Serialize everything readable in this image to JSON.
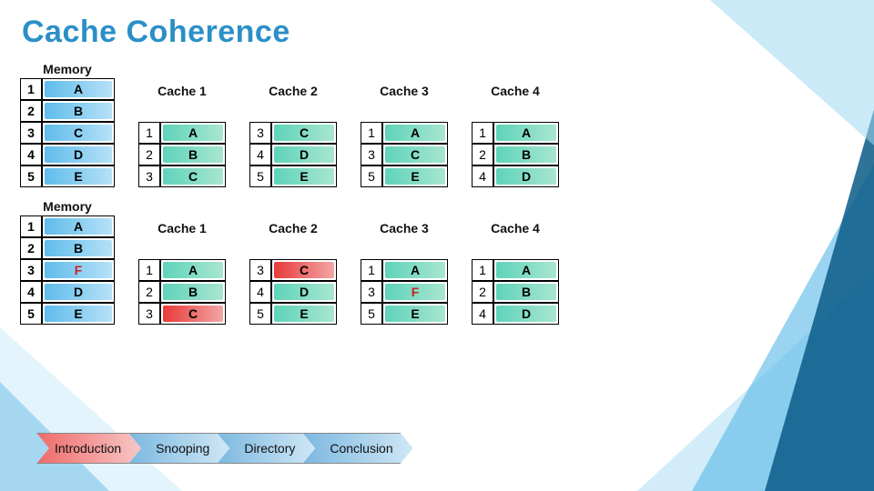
{
  "title": "Cache Coherence",
  "top": {
    "memory": {
      "header": "Memory",
      "rows": [
        {
          "i": "1",
          "v": "A",
          "bg": "blue"
        },
        {
          "i": "2",
          "v": "B",
          "bg": "blue"
        },
        {
          "i": "3",
          "v": "C",
          "bg": "blue"
        },
        {
          "i": "4",
          "v": "D",
          "bg": "blue"
        },
        {
          "i": "5",
          "v": "E",
          "bg": "blue"
        }
      ]
    },
    "caches": [
      {
        "header": "Cache 1",
        "rows": [
          {
            "i": "1",
            "v": "A",
            "bg": "teal"
          },
          {
            "i": "2",
            "v": "B",
            "bg": "teal"
          },
          {
            "i": "3",
            "v": "C",
            "bg": "teal"
          }
        ]
      },
      {
        "header": "Cache 2",
        "rows": [
          {
            "i": "3",
            "v": "C",
            "bg": "teal"
          },
          {
            "i": "4",
            "v": "D",
            "bg": "teal"
          },
          {
            "i": "5",
            "v": "E",
            "bg": "teal"
          }
        ]
      },
      {
        "header": "Cache 3",
        "rows": [
          {
            "i": "1",
            "v": "A",
            "bg": "teal"
          },
          {
            "i": "3",
            "v": "C",
            "bg": "teal"
          },
          {
            "i": "5",
            "v": "E",
            "bg": "teal"
          }
        ]
      },
      {
        "header": "Cache 4",
        "rows": [
          {
            "i": "1",
            "v": "A",
            "bg": "teal"
          },
          {
            "i": "2",
            "v": "B",
            "bg": "teal"
          },
          {
            "i": "4",
            "v": "D",
            "bg": "teal"
          }
        ]
      }
    ]
  },
  "bottom": {
    "memory": {
      "header": "Memory",
      "rows": [
        {
          "i": "1",
          "v": "A",
          "bg": "blue"
        },
        {
          "i": "2",
          "v": "B",
          "bg": "blue"
        },
        {
          "i": "3",
          "v": "F",
          "bg": "blue",
          "cls": "redtxt"
        },
        {
          "i": "4",
          "v": "D",
          "bg": "blue"
        },
        {
          "i": "5",
          "v": "E",
          "bg": "blue"
        }
      ]
    },
    "caches": [
      {
        "header": "Cache 1",
        "rows": [
          {
            "i": "1",
            "v": "A",
            "bg": "teal"
          },
          {
            "i": "2",
            "v": "B",
            "bg": "teal"
          },
          {
            "i": "3",
            "v": "C",
            "bg": "red"
          }
        ]
      },
      {
        "header": "Cache 2",
        "rows": [
          {
            "i": "3",
            "v": "C",
            "bg": "red"
          },
          {
            "i": "4",
            "v": "D",
            "bg": "teal"
          },
          {
            "i": "5",
            "v": "E",
            "bg": "teal"
          }
        ]
      },
      {
        "header": "Cache 3",
        "rows": [
          {
            "i": "1",
            "v": "A",
            "bg": "teal"
          },
          {
            "i": "3",
            "v": "F",
            "bg": "teal",
            "cls": "redtxt"
          },
          {
            "i": "5",
            "v": "E",
            "bg": "teal"
          }
        ]
      },
      {
        "header": "Cache 4",
        "rows": [
          {
            "i": "1",
            "v": "A",
            "bg": "teal"
          },
          {
            "i": "2",
            "v": "B",
            "bg": "teal"
          },
          {
            "i": "4",
            "v": "D",
            "bg": "teal"
          }
        ]
      }
    ]
  },
  "nav": [
    {
      "label": "Introduction",
      "color": "red"
    },
    {
      "label": "Snooping",
      "color": "blue"
    },
    {
      "label": "Directory",
      "color": "blue"
    },
    {
      "label": "Conclusion",
      "color": "blue"
    }
  ]
}
